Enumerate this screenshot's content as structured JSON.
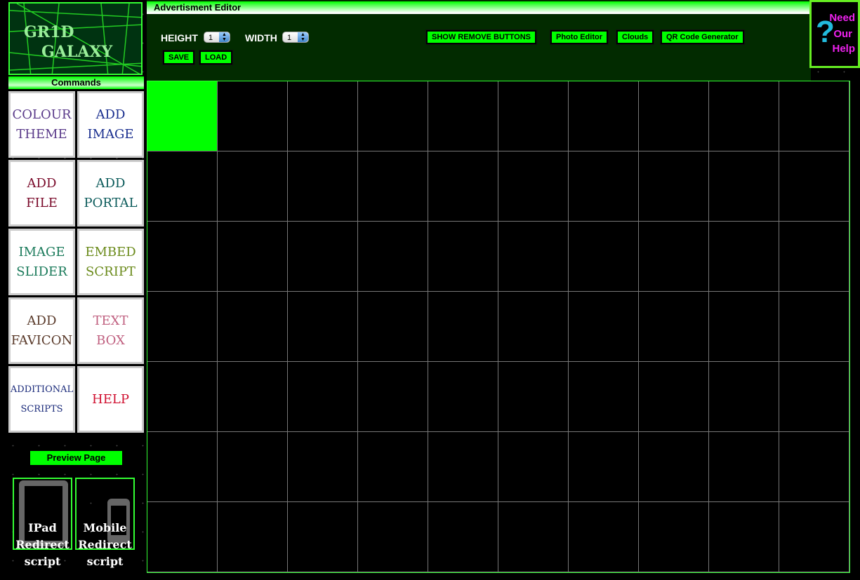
{
  "logo": {
    "line1": "GR1D",
    "line2": "GALAXY"
  },
  "sidebar": {
    "title": "Commands",
    "commands": [
      {
        "label": "COLOUR\nTHEME",
        "color": "#5a3a8a"
      },
      {
        "label": "ADD\nIMAGE",
        "color": "#1a2f8f"
      },
      {
        "label": "ADD\nFILE",
        "color": "#7a0a2a"
      },
      {
        "label": "ADD\nPORTAL",
        "color": "#0a5a5a"
      },
      {
        "label": "IMAGE\nSLIDER",
        "color": "#1a7a5a"
      },
      {
        "label": "EMBED\nSCRIPT",
        "color": "#6a8a1a"
      },
      {
        "label": "ADD\nFAVICON",
        "color": "#5a3a2a"
      },
      {
        "label": "TEXT\nBOX",
        "color": "#c06080"
      },
      {
        "label": "ADDITIONAL\nSCRIPTS",
        "color": "#1a2a7a"
      },
      {
        "label": "HELP",
        "color": "#d01030"
      }
    ],
    "preview": "Preview Page",
    "ipad": "IPad\nRedirect\nscript",
    "mobile": "Mobile\nRedirect\nscript"
  },
  "editor": {
    "title": "Advertisment Editor",
    "height_label": "HEIGHT",
    "height_value": "1",
    "width_label": "WIDTH",
    "width_value": "1",
    "save": "SAVE",
    "load": "LOAD",
    "show_remove": "SHOW REMOVE BUTTONS",
    "photo_editor": "Photo Editor",
    "clouds": "Clouds",
    "qr": "QR Code Generator"
  },
  "help_badge": {
    "q": "?",
    "w1": "Need",
    "w2": "Our",
    "w3": "Help"
  },
  "grid": {
    "columns": 10,
    "rows": 7,
    "selected_cells": [
      0
    ]
  }
}
